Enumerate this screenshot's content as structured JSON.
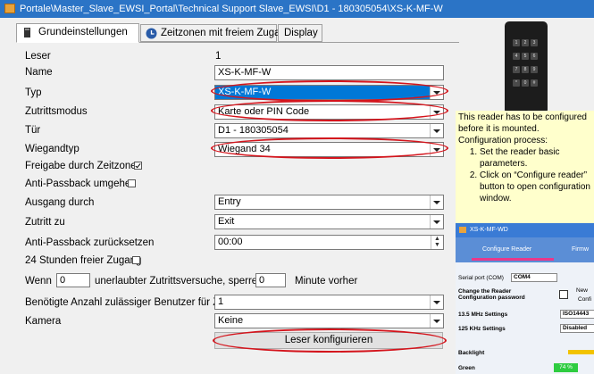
{
  "window": {
    "title": "Portale\\Master_Slave_EWSI_Portal\\Technical Support Slave_EWSI\\D1 - 180305054\\XS-K-MF-W"
  },
  "tabs": [
    {
      "label": "Grundeinstellungen"
    },
    {
      "label": "Zeitzonen mit freiem Zugang"
    },
    {
      "label": "Display"
    }
  ],
  "form": {
    "leser_label": "Leser",
    "leser_value": "1",
    "name_label": "Name",
    "name_value": "XS-K-MF-W",
    "typ_label": "Typ",
    "typ_value": "XS-K-MF-W",
    "modus_label": "Zutrittsmodus",
    "modus_value": "Karte oder PIN Code",
    "tuer_label": "Tür",
    "tuer_value": "D1 - 180305054",
    "wiegand_label": "Wiegandtyp",
    "wiegand_value": "Wiegand 34",
    "freigabe_label": "Freigabe durch Zeitzonen",
    "antipass_label": "Anti-Passback umgehen",
    "ausgang_label": "Ausgang durch",
    "ausgang_value": "Entry",
    "zutritt_label": "Zutritt zu",
    "zutritt_value": "Exit",
    "antireset_label": "Anti-Passback zurücksetzen",
    "antireset_value": "00:00",
    "h24_label": "24 Stunden freier Zugang",
    "wenn_label": "Wenn",
    "wenn_value": "0",
    "versuche_label": "unerlaubter Zutrittsversuche, sperren für",
    "sperren_value": "0",
    "minute_label": "Minute vorher",
    "benutzer_label": "Benötigte Anzahl zulässiger Benutzer für Zutritt",
    "benutzer_value": "1",
    "kamera_label": "Kamera",
    "kamera_value": "Keine",
    "configure_button": "Leser konfigurieren"
  },
  "keypad": {
    "keys": [
      "1",
      "2",
      "3",
      "4",
      "5",
      "6",
      "7",
      "8",
      "9",
      "*",
      "0",
      "#"
    ]
  },
  "note": {
    "line1": "This reader has to be configured before it is mounted.",
    "line2": "Configuration process:",
    "steps": [
      "Set the reader basic parameters.",
      "Click on “Configure reader” button to open configuration window."
    ]
  },
  "mini": {
    "title": "XS-K-MF-WD",
    "tab1": "Configure Reader",
    "tab2": "Firmw",
    "serial_label": "Serial port (COM)",
    "serial_value": "COM4",
    "change_label": "Change the Reader Configuration password",
    "new_label": "New",
    "conf_label": "Confi",
    "s135_label": "13.5 MHz Settings",
    "s135_value": "ISO14443",
    "s125_label": "125 KHz Settings",
    "s125_value": "Disabled",
    "backlight_label": "Backlight",
    "green_label": "Green",
    "green_value": "74 %"
  },
  "colors": {
    "titlebar": "#2b74c6",
    "highlight": "#0078d7",
    "annotation": "#d4141c",
    "note_bg": "#ffffcc"
  }
}
